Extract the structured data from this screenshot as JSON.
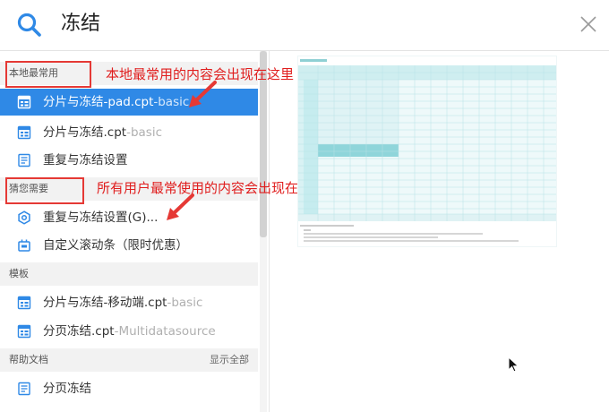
{
  "search": {
    "query": "冻结"
  },
  "sections": [
    {
      "title": "本地最常用",
      "items": [
        {
          "name": "分片与冻结-pad.cpt",
          "sub": "-basic",
          "selected": true,
          "icon": "report-file-icon"
        },
        {
          "name": "分片与冻结.cpt",
          "sub": "-basic",
          "selected": false,
          "icon": "report-file-icon"
        },
        {
          "name": "重复与冻结设置",
          "sub": "",
          "selected": false,
          "icon": "document-icon"
        }
      ]
    },
    {
      "title": "猜您需要",
      "items": [
        {
          "name": "重复与冻结设置(G)...",
          "sub": "",
          "selected": false,
          "icon": "gear-icon"
        },
        {
          "name": "自定义滚动条（限时优惠）",
          "sub": "",
          "selected": false,
          "icon": "plugin-icon"
        }
      ]
    },
    {
      "title": "模板",
      "items": [
        {
          "name": "分片与冻结-移动端.cpt",
          "sub": "-basic",
          "selected": false,
          "icon": "report-file-icon"
        },
        {
          "name": "分页冻结.cpt",
          "sub": "-Multidatasource",
          "selected": false,
          "icon": "report-file-icon"
        }
      ]
    },
    {
      "title": "帮助文档",
      "action": "显示全部",
      "items": [
        {
          "name": "分页冻结",
          "sub": "",
          "selected": false,
          "icon": "document-icon"
        }
      ]
    }
  ],
  "annotations": {
    "local": "本地最常用的内容会出现在这里",
    "guess": "所有用户最常使用的内容会出现在这里"
  },
  "colors": {
    "accent": "#2f89e6",
    "annotation": "#e53935",
    "icon": "#2f89e6"
  }
}
